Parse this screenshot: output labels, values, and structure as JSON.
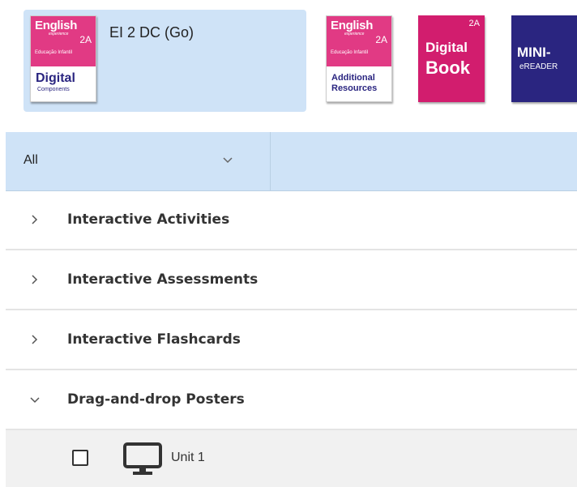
{
  "products": {
    "selected": {
      "title": "EI 2 DC (Go)",
      "cover": {
        "brand": "English",
        "brand_sub": "experience",
        "level": "2A",
        "subtitle": "Educação Infantil",
        "main": "Digital",
        "sub": "Components"
      }
    },
    "additional": {
      "brand": "English",
      "brand_sub": "experience",
      "level": "2A",
      "subtitle": "Educação Infantil",
      "line1": "Additional",
      "line2": "Resources"
    },
    "digital_book": {
      "level": "2A",
      "line1": "Digital",
      "line2": "Book"
    },
    "mini_reader": {
      "line1": "MINI-",
      "line2": "eREADER"
    }
  },
  "filter": {
    "value": "All",
    "icon": "chevron-down-icon"
  },
  "sections": [
    {
      "label": "Interactive Activities",
      "expanded": false
    },
    {
      "label": "Interactive Assessments",
      "expanded": false
    },
    {
      "label": "Interactive Flashcards",
      "expanded": false
    },
    {
      "label": "Drag-and-drop Posters",
      "expanded": true
    }
  ],
  "posters": {
    "items": [
      {
        "label": "Unit 1",
        "icon": "monitor-icon",
        "checked": false
      }
    ]
  },
  "colors": {
    "selected_bg": "#cfe3f7",
    "brand_pink": "#e13a84",
    "brand_navy": "#2a2580"
  }
}
